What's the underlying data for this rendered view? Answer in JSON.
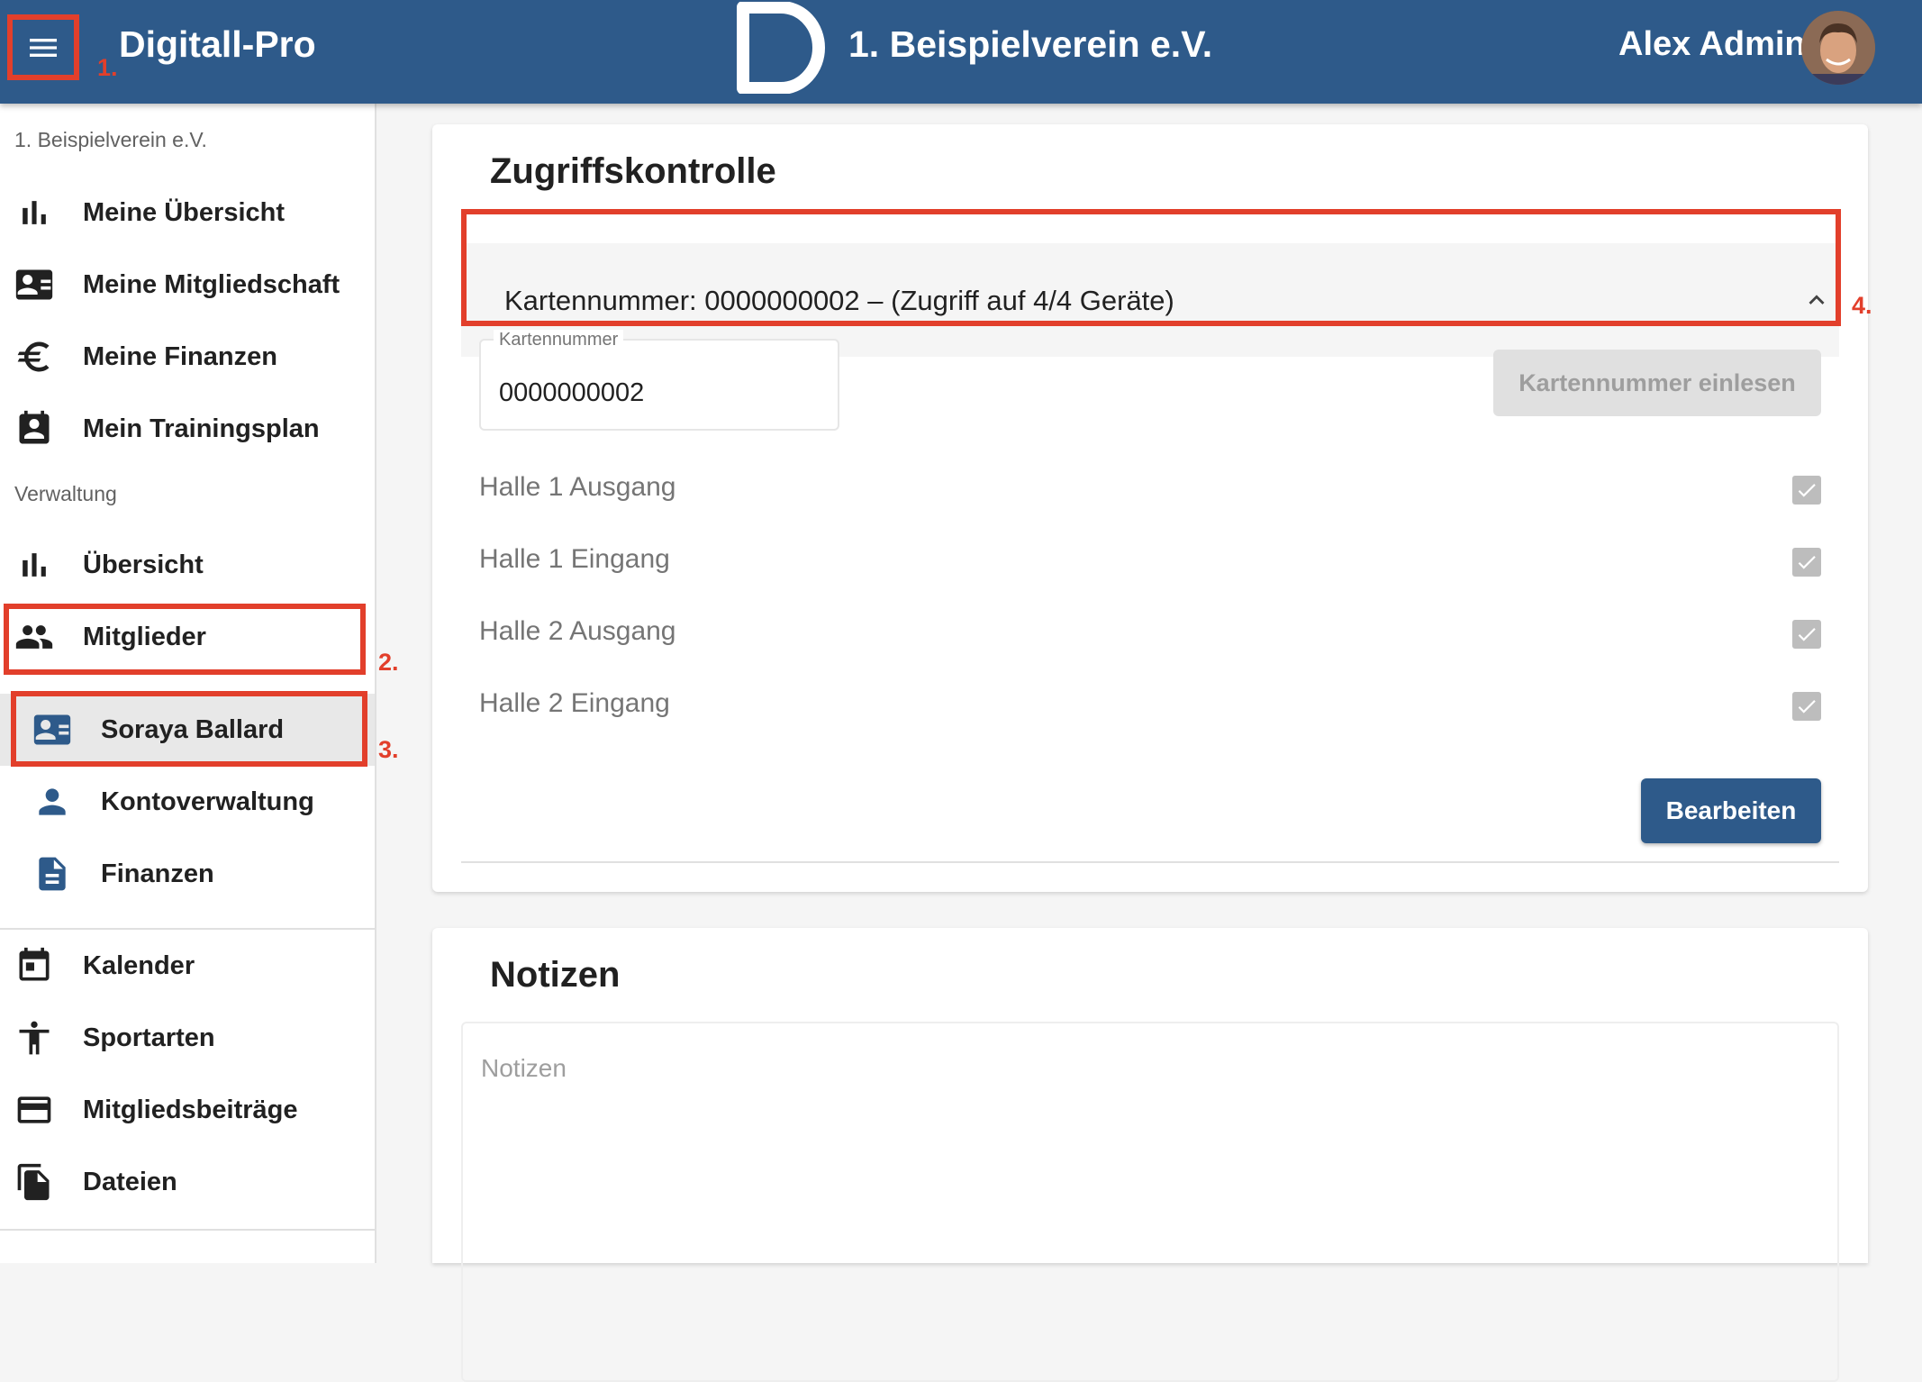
{
  "topbar": {
    "app_title": "Digitall-Pro",
    "club_title": "1. Beispielverein e.V.",
    "user_name": "Alex Admin",
    "menu_icon": "hamburger-icon",
    "annotation": "1."
  },
  "sidebar": {
    "club_header": "1. Beispielverein e.V.",
    "personal_items": [
      {
        "label": "Meine Übersicht",
        "icon": "bar-chart-icon"
      },
      {
        "label": "Meine Mitgliedschaft",
        "icon": "id-card-icon"
      },
      {
        "label": "Meine Finanzen",
        "icon": "euro-icon"
      },
      {
        "label": "Mein Trainingsplan",
        "icon": "calendar-person-icon"
      }
    ],
    "admin_header": "Verwaltung",
    "admin_items": [
      {
        "label": "Übersicht",
        "icon": "bar-chart-icon"
      },
      {
        "label": "Mitglieder",
        "icon": "people-icon",
        "annotation": "2."
      }
    ],
    "member_items": [
      {
        "label": "Soraya Ballard",
        "icon": "id-card-icon",
        "annotation": "3.",
        "selected": true
      },
      {
        "label": "Kontoverwaltung",
        "icon": "person-icon"
      },
      {
        "label": "Finanzen",
        "icon": "document-icon"
      }
    ],
    "general_items": [
      {
        "label": "Kalender",
        "icon": "calendar-icon"
      },
      {
        "label": "Sportarten",
        "icon": "sports-icon"
      },
      {
        "label": "Mitgliedsbeiträge",
        "icon": "credit-card-icon"
      },
      {
        "label": "Dateien",
        "icon": "files-icon"
      }
    ]
  },
  "access_control": {
    "title": "Zugriffskontrolle",
    "panel_header": "Kartennummer: 0000000002  –  (Zugriff auf 4/4 Geräte)",
    "panel_annotation": "4.",
    "card_field_label": "Kartennummer",
    "card_field_value": "0000000002",
    "read_card_button": "Kartennummer einlesen",
    "devices": [
      {
        "label": "Halle 1 Ausgang",
        "checked": true
      },
      {
        "label": "Halle 1 Eingang",
        "checked": true
      },
      {
        "label": "Halle 2 Ausgang",
        "checked": true
      },
      {
        "label": "Halle 2 Eingang",
        "checked": true
      }
    ],
    "edit_button": "Bearbeiten"
  },
  "notes": {
    "title": "Notizen",
    "placeholder": "Notizen"
  },
  "colors": {
    "primary": "#2e5a8a",
    "annotation": "#e23f2b"
  }
}
